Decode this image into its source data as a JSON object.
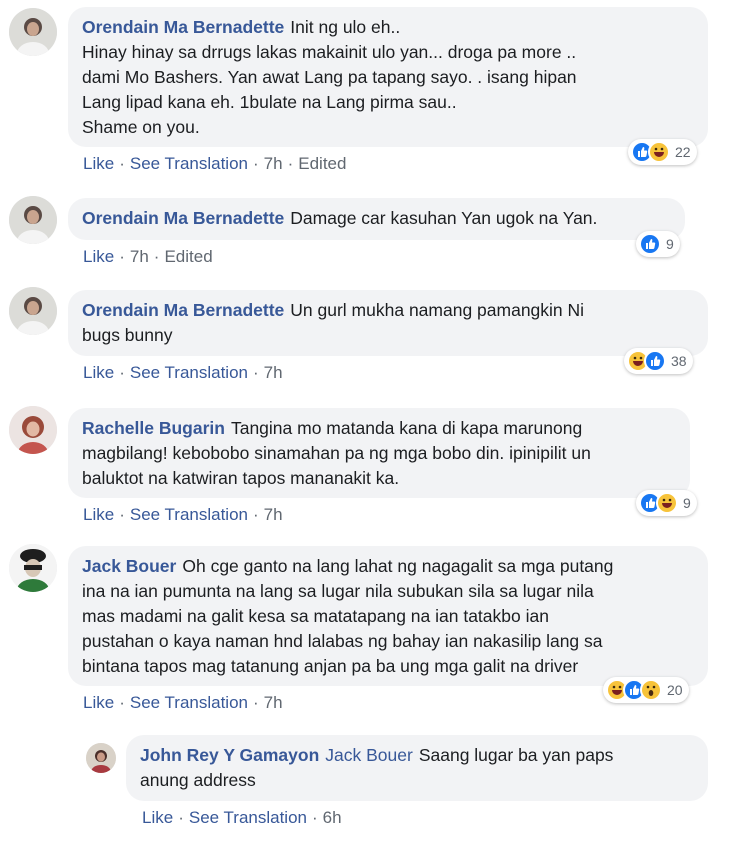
{
  "comments": [
    {
      "author": "Orendain Ma Bernadette",
      "text": "Init ng ulo eh..\nHinay hinay sa drrugs lakas makainit ulo yan... droga pa more ..\ndami Mo Bashers. Yan awat Lang pa tapang sayo. . isang hipan\nLang lipad kana eh. 1bulate na Lang pirma sau..\nShame on you.",
      "actions": [
        "Like",
        "See Translation"
      ],
      "time": "7h",
      "edited": "Edited",
      "reaction_count": "22",
      "reactions": [
        "like-icon",
        "haha-icon"
      ]
    },
    {
      "author": "Orendain Ma Bernadette",
      "text": "Damage car kasuhan Yan ugok na Yan.",
      "actions": [
        "Like"
      ],
      "time": "7h",
      "edited": "Edited",
      "reaction_count": "9",
      "reactions": [
        "like-icon"
      ]
    },
    {
      "author": "Orendain Ma Bernadette",
      "text": "Un gurl mukha namang pamangkin Ni\nbugs bunny",
      "actions": [
        "Like",
        "See Translation"
      ],
      "time": "7h",
      "reaction_count": "38",
      "reactions": [
        "haha-icon",
        "like-icon"
      ]
    },
    {
      "author": "Rachelle Bugarin",
      "text": "Tangina mo matanda kana di kapa marunong\nmagbilang! kebobobo sinamahan pa ng mga bobo din. ipinipilit un\nbaluktot na katwiran tapos mananakit ka.",
      "actions": [
        "Like",
        "See Translation"
      ],
      "time": "7h",
      "reaction_count": "9",
      "reactions": [
        "like-icon",
        "haha-icon"
      ]
    },
    {
      "author": "Jack Bouer",
      "text": "Oh cge ganto na lang lahat ng nagagalit sa mga putang\nina na ian pumunta na lang sa lugar nila subukan sila sa lugar nila\nmas madami na galit kesa sa matatapang na ian tatakbo ian\npustahan o kaya naman hnd lalabas ng bahay ian nakasilip lang sa\nbintana tapos mag tatanung anjan pa ba ung mga galit na driver",
      "actions": [
        "Like",
        "See Translation"
      ],
      "time": "7h",
      "reaction_count": "20",
      "reactions": [
        "haha-icon",
        "like-icon",
        "wow-icon"
      ]
    },
    {
      "author": "John Rey Y Gamayon",
      "mention": "Jack Bouer",
      "text": "Saang lugar ba yan paps\nanung address",
      "actions": [
        "Like",
        "See Translation"
      ],
      "time": "6h"
    }
  ],
  "colors": {
    "name": "#385898",
    "bubble": "#f2f3f5",
    "meta": "#606770",
    "like": "#1877f2",
    "haha": "#f7c33a"
  }
}
